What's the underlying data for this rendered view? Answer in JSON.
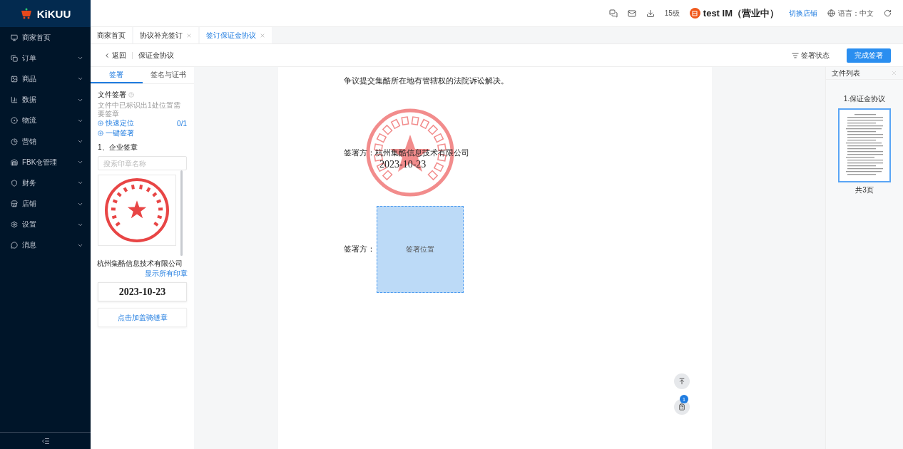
{
  "logo": {
    "text": "KiKUU"
  },
  "header": {
    "level": "15级",
    "shop_name": "test IM（营业中）",
    "switch_shop": "切换店铺",
    "language": "语言：中文"
  },
  "sidebar": {
    "items": [
      {
        "label": "商家首页",
        "expandable": false
      },
      {
        "label": "订单",
        "expandable": true
      },
      {
        "label": "商品",
        "expandable": true
      },
      {
        "label": "数据",
        "expandable": true
      },
      {
        "label": "物流",
        "expandable": true
      },
      {
        "label": "营销",
        "expandable": true
      },
      {
        "label": "FBK仓管理",
        "expandable": true
      },
      {
        "label": "财务",
        "expandable": true
      },
      {
        "label": "店铺",
        "expandable": true
      },
      {
        "label": "设置",
        "expandable": true
      },
      {
        "label": "消息",
        "expandable": true
      }
    ]
  },
  "tabs": [
    {
      "label": "商家首页",
      "selected": false,
      "closable": false
    },
    {
      "label": "协议补充签订",
      "selected": false,
      "closable": true
    },
    {
      "label": "签订保证金协议",
      "selected": true,
      "closable": true
    }
  ],
  "breadcrumb": {
    "back": "返回",
    "title": "保证金协议"
  },
  "actions": {
    "status": "签署状态",
    "finish": "完成签署"
  },
  "left_panel": {
    "tabs": [
      {
        "label": "签署",
        "selected": true
      },
      {
        "label": "签名与证书",
        "selected": false
      }
    ],
    "section_title": "文件签署",
    "hint": "文件中已标识出1处位置需要签章",
    "quick_locate": "快速定位",
    "progress": "0/1",
    "one_click": "一键签署",
    "group_title": "1、企业签章",
    "search": {
      "placeholder": "搜索印章名称"
    },
    "seal_name": "杭州集酷信息技术有限公司",
    "show_all": "显示所有印章",
    "date": "2023-10-23",
    "riding_seal": "点击加盖骑缝章"
  },
  "document": {
    "paragraph": "争议提交集酷所在地有管辖权的法院诉讼解决。",
    "signers": [
      {
        "label": "签署方：",
        "name": "杭州集酷信息技术有限公司",
        "date": "2023-10-23",
        "signed": true
      },
      {
        "label": "签署方：",
        "signed": false,
        "slot": "签署位置"
      }
    ]
  },
  "file_list": {
    "title": "文件列表",
    "files": [
      {
        "name": "1.保证金协议",
        "pages": "共3页",
        "selected": true
      }
    ]
  },
  "floating": {
    "badge": "1"
  }
}
